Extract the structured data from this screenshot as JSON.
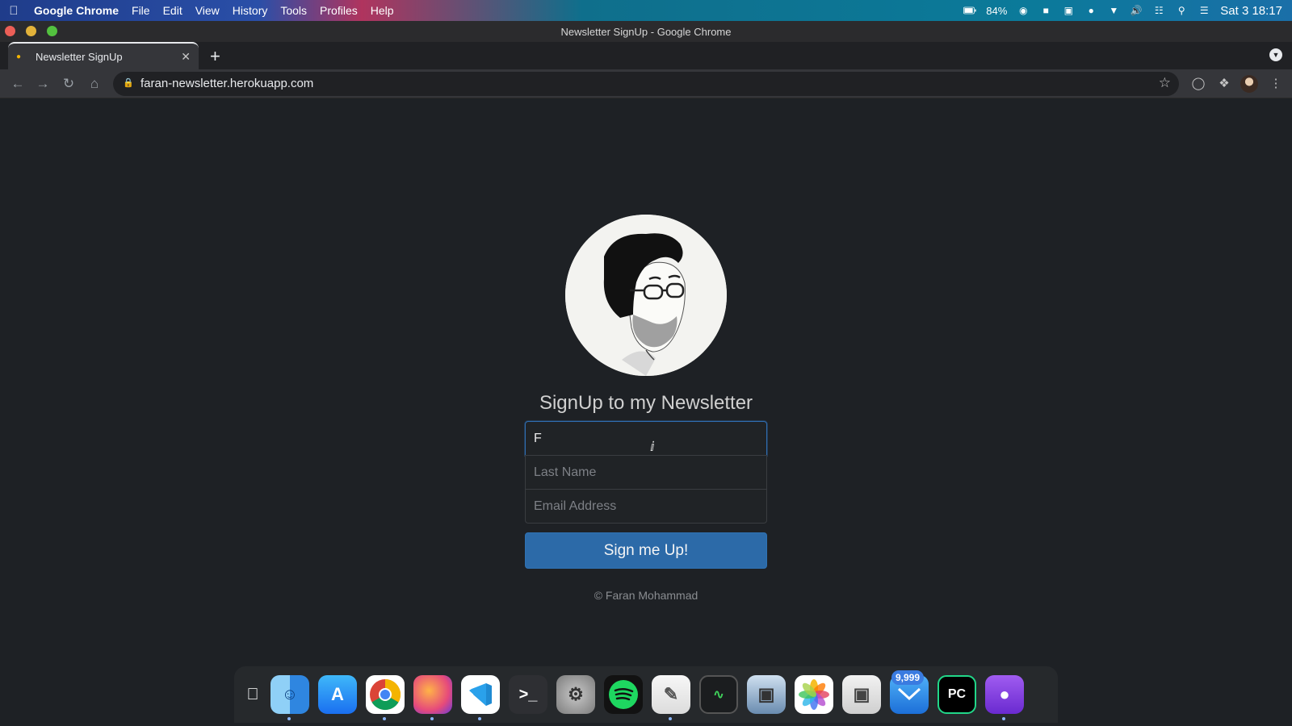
{
  "menubar": {
    "app_name": "Google Chrome",
    "menus": [
      "File",
      "Edit",
      "View",
      "History",
      "Tools",
      "Profiles",
      "Help"
    ],
    "battery": "84%",
    "clock": "Sat 3 18:17"
  },
  "window": {
    "title": "Newsletter SignUp - Google Chrome"
  },
  "tab": {
    "title": "Newsletter SignUp"
  },
  "omnibox": {
    "url": "faran-newsletter.herokuapp.com"
  },
  "page": {
    "heading": "SignUp to my Newsletter",
    "first_name_value": "F",
    "last_name_placeholder": "Last Name",
    "email_placeholder": "Email Address",
    "submit_label": "Sign me Up!",
    "footer": "© Faran Mohammad"
  },
  "dock": {
    "badge_count": "9,999",
    "pycharm_label": "PC",
    "terminal_label": ">_"
  },
  "colors": {
    "page_bg": "#1e2125",
    "button_bg": "#2c6aa8",
    "focus_border": "#2f6db0"
  }
}
